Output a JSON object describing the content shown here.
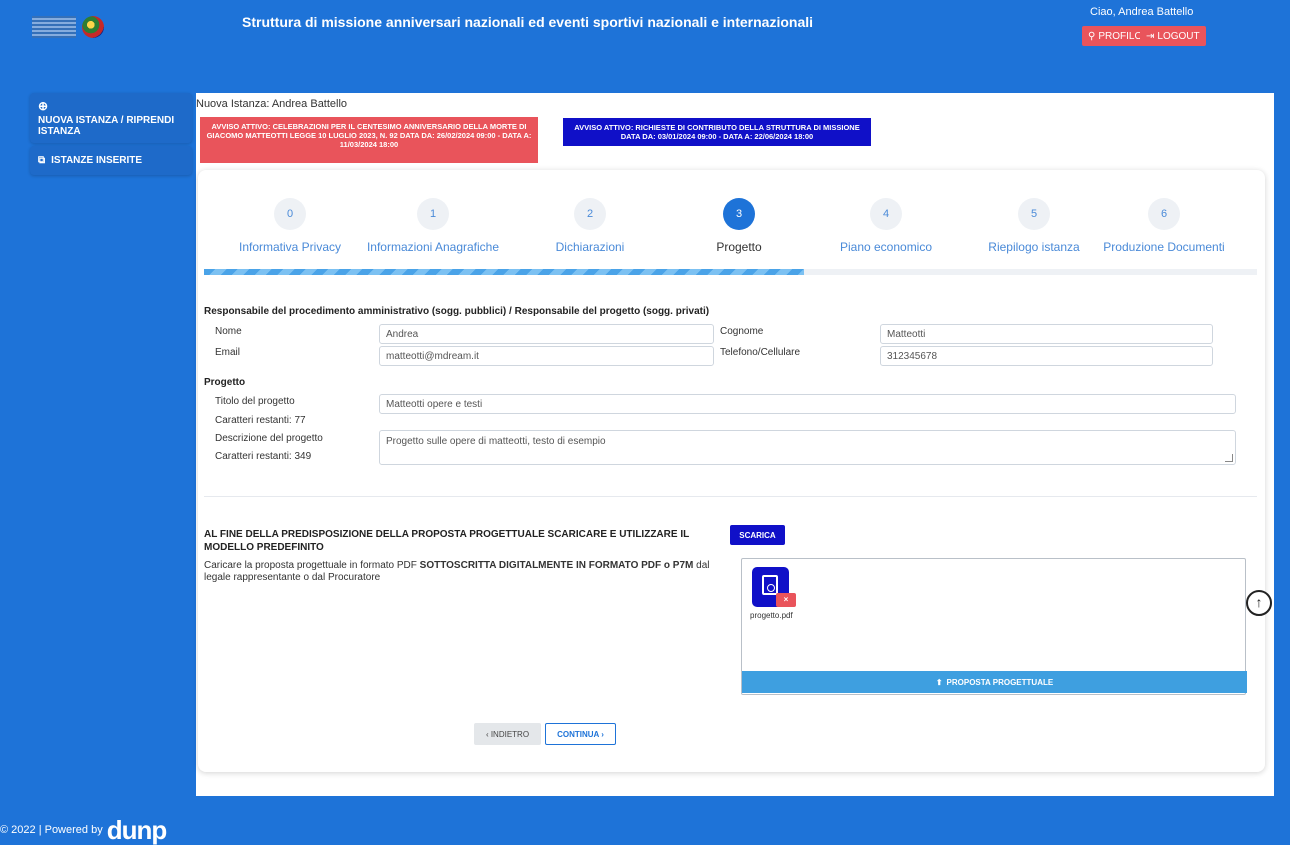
{
  "header": {
    "title": "Struttura di missione anniversari nazionali ed eventi sportivi nazionali e internazionali",
    "greeting": "Ciao, Andrea Battello",
    "profile_label": "PROFILO",
    "logout_label": "LOGOUT"
  },
  "sidebar": {
    "new_instance_label": "NUOVA ISTANZA / RIPRENDI ISTANZA",
    "inserted_label": "ISTANZE INSERITE"
  },
  "breadcrumb": "Nuova Istanza: Andrea Battello",
  "notices": {
    "red": "AVVISO ATTIVO: CELEBRAZIONI PER IL CENTESIMO ANNIVERSARIO DELLA MORTE DI GIACOMO MATTEOTTI LEGGE 10 LUGLIO 2023, N. 92 DATA DA: 26/02/2024 09:00 - DATA A: 11/03/2024 18:00",
    "blue": "AVVISO ATTIVO: RICHIESTE DI CONTRIBUTO DELLA STRUTTURA DI MISSIONE DATA DA: 03/01/2024 09:00 - DATA A: 22/06/2024 18:00"
  },
  "steps": [
    {
      "num": "0",
      "label": "Informativa Privacy"
    },
    {
      "num": "1",
      "label": "Informazioni Anagrafiche"
    },
    {
      "num": "2",
      "label": "Dichiarazioni"
    },
    {
      "num": "3",
      "label": "Progetto"
    },
    {
      "num": "4",
      "label": "Piano economico"
    },
    {
      "num": "5",
      "label": "Riepilogo istanza"
    },
    {
      "num": "6",
      "label": "Produzione Documenti"
    }
  ],
  "active_step": 3,
  "progress_fraction": 0.57,
  "responsabile": {
    "section_title": "Responsabile del procedimento amministrativo (sogg. pubblici) / Responsabile del progetto (sogg. privati)",
    "nome_label": "Nome",
    "nome_value": "Andrea",
    "cognome_label": "Cognome",
    "cognome_value": "Matteotti",
    "email_label": "Email",
    "email_value": "matteotti@mdream.it",
    "telefono_label": "Telefono/Cellulare",
    "telefono_value": "312345678"
  },
  "progetto": {
    "section_title": "Progetto",
    "titolo_label": "Titolo del progetto",
    "titolo_value": "Matteotti opere e testi",
    "titolo_remaining": "Caratteri restanti: 77",
    "descrizione_label": "Descrizione del progetto",
    "descrizione_value": "Progetto sulle opere di matteotti, testo di esempio",
    "descrizione_remaining": "Caratteri restanti: 349"
  },
  "download": {
    "title": "AL FINE DELLA PREDISPOSIZIONE DELLA PROPOSTA PROGETTUALE SCARICARE E UTILIZZARE IL MODELLO PREDEFINITO",
    "text_before": "Caricare la proposta progettuale in formato PDF ",
    "text_bold": "SOTTOSCRITTA DIGITALMENTE IN FORMATO PDF o P7M",
    "text_after": " dal legale rappresentante o dal Procuratore",
    "scarica_label": "SCARICA"
  },
  "upload": {
    "file_name": "progetto.pdf",
    "remove_label": "×",
    "button_label": "PROPOSTA PROGETTUALE"
  },
  "nav": {
    "back_label": "‹ INDIETRO",
    "next_label": "CONTINUA ›"
  },
  "footer": {
    "copyright": "© 2022 | Powered by",
    "brand": "dunp"
  },
  "colors": {
    "primary_blue": "#1e73d8",
    "notice_red": "#e9545b",
    "notice_blue": "#1010c8",
    "upload_blue": "#3e9fe0"
  }
}
